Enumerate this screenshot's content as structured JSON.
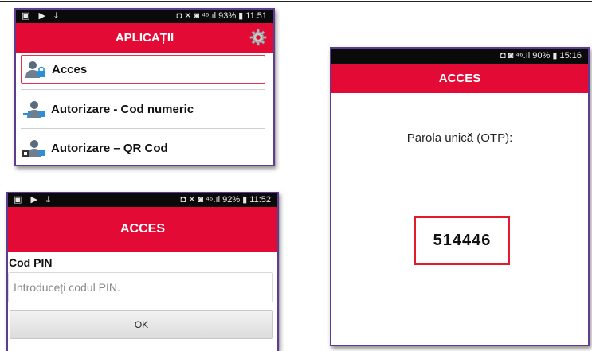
{
  "screen_apps": {
    "status_left": "▣ ▶ ⤓",
    "status_right": "◘ ✕ ◙ ⁴⁵.ıl 93% ▮ 11:51",
    "title": "APLICAȚII",
    "gear_icon": "gear-icon",
    "menu": [
      {
        "label": "Acces",
        "icon": "user-lock-icon",
        "selected": true
      },
      {
        "label": "Autorizare - Cod numeric",
        "icon": "user-arrows-icon",
        "selected": false
      },
      {
        "label": "Autorizare – QR Cod",
        "icon": "user-qr-icon",
        "selected": false
      }
    ]
  },
  "screen_pin": {
    "status_left": "▣ ▶ ⤓",
    "status_right": "◘ ✕ ◙ ⁴⁵.ıl 92% ▮ 11:52",
    "title": "ACCES",
    "pin_label": "Cod PIN",
    "pin_placeholder": "Introduceți codul PIN.",
    "ok_label": "OK"
  },
  "screen_otp": {
    "status_right": "◘ ◙ ⁴⁶.ıl 90% ▮ 15:16",
    "title": "ACCES",
    "otp_label": "Parola unică (OTP):",
    "otp_value": "514446"
  },
  "colors": {
    "appbar": "#e40a36",
    "frame": "#5d3d8f",
    "highlight": "#e21a2b"
  }
}
